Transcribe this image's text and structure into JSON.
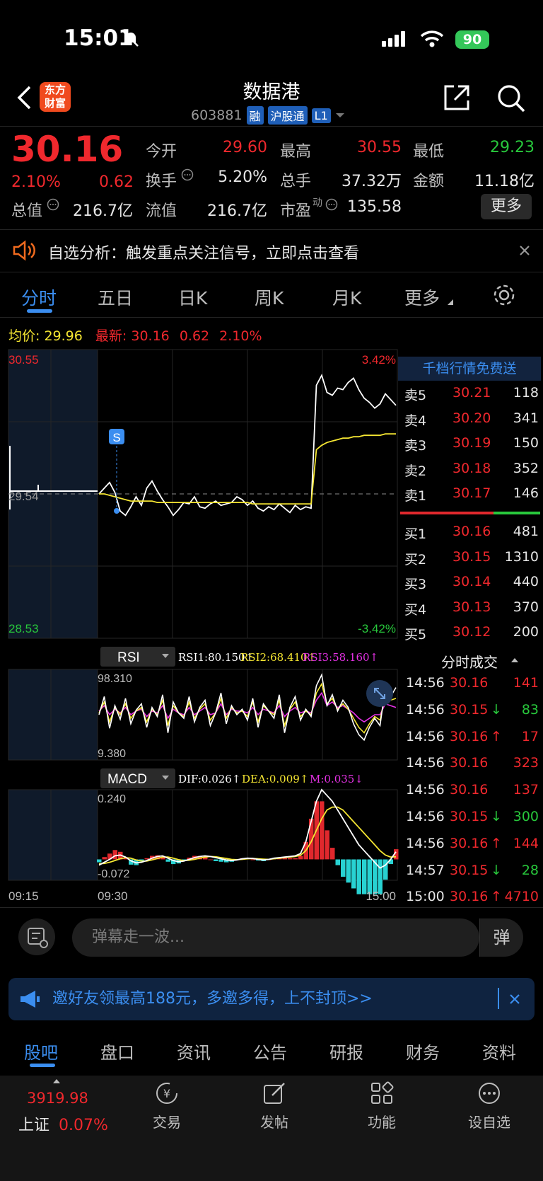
{
  "status_bar": {
    "time": "15:01",
    "battery": "90"
  },
  "header": {
    "logo_text": "东方财富",
    "title": "数据港",
    "code": "603881",
    "tags": [
      "融",
      "沪股通",
      "L1"
    ]
  },
  "quote": {
    "price": "30.16",
    "change_pct": "2.10%",
    "change": "0.62",
    "open_label": "今开",
    "open": "29.60",
    "high_label": "最高",
    "high": "30.55",
    "low_label": "最低",
    "low": "29.23",
    "turnover_label": "换手",
    "turnover": "5.20%",
    "volume_label": "总手",
    "volume": "37.32万",
    "amount_label": "金额",
    "amount": "11.18亿",
    "mktcap_label": "总值",
    "mktcap": "216.7亿",
    "float_label": "流值",
    "float": "216.7亿",
    "pe_label": "市盈",
    "pe_sup": "动",
    "pe": "135.58",
    "more": "更多"
  },
  "notice": {
    "text": "自选分析：触发重点关注信号，立即点击查看"
  },
  "chart_tabs": [
    "分时",
    "五日",
    "日K",
    "周K",
    "月K",
    "更多"
  ],
  "avg_line": {
    "avg_label": "均价:",
    "avg": "29.96",
    "latest_label": "最新:",
    "latest": "30.16",
    "change": "0.62",
    "pct": "2.10%"
  },
  "order_book": {
    "title": "千档行情免费送",
    "asks": [
      {
        "label": "卖5",
        "price": "30.21",
        "vol": "118"
      },
      {
        "label": "卖4",
        "price": "30.20",
        "vol": "341"
      },
      {
        "label": "卖3",
        "price": "30.19",
        "vol": "150"
      },
      {
        "label": "卖2",
        "price": "30.18",
        "vol": "352"
      },
      {
        "label": "卖1",
        "price": "30.17",
        "vol": "146"
      }
    ],
    "bids": [
      {
        "label": "买1",
        "price": "30.16",
        "vol": "481"
      },
      {
        "label": "买2",
        "price": "30.15",
        "vol": "1310"
      },
      {
        "label": "买3",
        "price": "30.14",
        "vol": "440"
      },
      {
        "label": "买4",
        "price": "30.13",
        "vol": "370"
      },
      {
        "label": "买5",
        "price": "30.12",
        "vol": "200"
      }
    ]
  },
  "trades": {
    "title": "分时成交",
    "rows": [
      {
        "time": "14:56",
        "price": "30.16",
        "arrow": "",
        "vol": "141",
        "dir": "up"
      },
      {
        "time": "14:56",
        "price": "30.15",
        "arrow": "↓",
        "vol": "83",
        "dir": "down"
      },
      {
        "time": "14:56",
        "price": "30.16",
        "arrow": "↑",
        "vol": "17",
        "dir": "up"
      },
      {
        "time": "14:56",
        "price": "30.16",
        "arrow": "",
        "vol": "323",
        "dir": "up"
      },
      {
        "time": "14:56",
        "price": "30.16",
        "arrow": "",
        "vol": "137",
        "dir": "up"
      },
      {
        "time": "14:56",
        "price": "30.15",
        "arrow": "↓",
        "vol": "300",
        "dir": "down"
      },
      {
        "time": "14:56",
        "price": "30.16",
        "arrow": "↑",
        "vol": "144",
        "dir": "up"
      },
      {
        "time": "14:57",
        "price": "30.15",
        "arrow": "↓",
        "vol": "28",
        "dir": "down"
      },
      {
        "time": "15:00",
        "price": "30.16",
        "arrow": "↑",
        "vol": "4710",
        "dir": "up"
      }
    ]
  },
  "chart_data": [
    {
      "type": "line",
      "series": [
        {
          "name": "最新"
        },
        {
          "name": "均价"
        }
      ],
      "y_top": "30.55",
      "y_mid": "29.54",
      "y_bottom": "28.53",
      "pct_top": "3.42%",
      "pct_bottom": "-3.42%",
      "signal_marker": "S",
      "y_range": [
        28.53,
        30.55
      ],
      "x_ticks": [
        "09:15",
        "09:30",
        "15:00"
      ],
      "price": [
        29.54,
        29.58,
        29.62,
        29.55,
        29.42,
        29.39,
        29.45,
        29.52,
        29.46,
        29.58,
        29.63,
        29.56,
        29.5,
        29.45,
        29.39,
        29.43,
        29.48,
        29.47,
        29.52,
        29.45,
        29.44,
        29.47,
        29.49,
        29.46,
        29.47,
        29.48,
        29.52,
        29.5,
        29.46,
        29.49,
        29.44,
        29.42,
        29.45,
        29.43,
        29.47,
        29.44,
        29.41,
        29.46,
        29.43,
        29.45,
        29.44,
        30.3,
        30.37,
        30.25,
        30.23,
        30.28,
        30.27,
        30.32,
        30.35,
        30.27,
        30.21,
        30.18,
        30.14,
        30.17,
        30.24,
        30.2,
        30.16
      ],
      "avg": [
        29.54,
        29.54,
        29.53,
        29.52,
        29.51,
        29.5,
        29.49,
        29.49,
        29.49,
        29.49,
        29.49,
        29.48,
        29.48,
        29.48,
        29.48,
        29.48,
        29.48,
        29.48,
        29.48,
        29.48,
        29.48,
        29.48,
        29.48,
        29.48,
        29.48,
        29.48,
        29.48,
        29.48,
        29.48,
        29.47,
        29.47,
        29.47,
        29.47,
        29.47,
        29.47,
        29.47,
        29.47,
        29.47,
        29.47,
        29.47,
        29.47,
        29.85,
        29.88,
        29.9,
        29.91,
        29.92,
        29.93,
        29.93,
        29.94,
        29.94,
        29.95,
        29.95,
        29.95,
        29.95,
        29.96,
        29.96,
        29.96
      ]
    },
    {
      "type": "line",
      "indicator": "RSI",
      "series": [
        {
          "name": "RSI1",
          "label": "RSI1:80.150",
          "arrow": "↑",
          "color": "#ffffff"
        },
        {
          "name": "RSI2",
          "label": "RSI2:68.410",
          "arrow": "↑",
          "color": "#f5e632"
        },
        {
          "name": "RSI3",
          "label": "RSI3:58.160",
          "arrow": "↑",
          "color": "#e632e6"
        }
      ],
      "y_top": "98.310",
      "y_bottom": "9.380",
      "y_range": [
        9.38,
        98.31
      ],
      "rsi1": [
        50,
        70,
        35,
        60,
        45,
        68,
        40,
        55,
        62,
        36,
        58,
        48,
        72,
        30,
        64,
        52,
        46,
        70,
        42,
        58,
        66,
        38,
        52,
        74,
        40,
        60,
        50,
        56,
        44,
        68,
        36,
        62,
        54,
        46,
        72,
        30,
        58,
        70,
        44,
        56,
        48,
        82,
        94,
        60,
        72,
        54,
        66,
        58,
        40,
        28,
        22,
        36,
        46,
        38,
        80,
        70,
        80
      ],
      "rsi2": [
        52,
        64,
        42,
        58,
        50,
        62,
        46,
        54,
        58,
        42,
        56,
        50,
        66,
        38,
        60,
        52,
        48,
        64,
        46,
        56,
        62,
        44,
        52,
        68,
        46,
        58,
        52,
        54,
        48,
        64,
        42,
        60,
        54,
        50,
        66,
        38,
        56,
        64,
        48,
        54,
        50,
        74,
        84,
        62,
        68,
        56,
        62,
        56,
        46,
        36,
        30,
        40,
        48,
        44,
        72,
        66,
        68
      ],
      "rsi3": [
        54,
        60,
        50,
        56,
        52,
        58,
        50,
        54,
        56,
        48,
        54,
        52,
        60,
        46,
        56,
        52,
        50,
        58,
        50,
        54,
        58,
        50,
        52,
        62,
        50,
        56,
        54,
        54,
        52,
        58,
        50,
        56,
        54,
        52,
        60,
        48,
        54,
        58,
        52,
        54,
        52,
        66,
        74,
        60,
        64,
        58,
        60,
        56,
        52,
        46,
        42,
        46,
        50,
        50,
        62,
        60,
        58
      ]
    },
    {
      "type": "bar",
      "indicator": "MACD",
      "series": [
        {
          "name": "DIF",
          "label": "DIF:0.026",
          "arrow": "↑",
          "color": "#ffffff"
        },
        {
          "name": "DEA",
          "label": "DEA:0.009",
          "arrow": "↑",
          "color": "#f5e632"
        },
        {
          "name": "M",
          "label": "M:0.035",
          "arrow": "↓",
          "color": "#e632e6"
        }
      ],
      "y_top": "0.240",
      "y_bottom": "-0.072",
      "y_range": [
        -0.072,
        0.24
      ],
      "dif": [
        -0.02,
        -0.01,
        0.0,
        0.012,
        0.015,
        0.008,
        -0.005,
        -0.012,
        -0.01,
        -0.004,
        0.004,
        0.01,
        0.012,
        0.004,
        -0.004,
        -0.008,
        -0.006,
        0.0,
        0.006,
        0.01,
        0.012,
        0.01,
        0.006,
        0.002,
        -0.002,
        -0.004,
        -0.002,
        0.002,
        0.004,
        0.003,
        0.0,
        -0.002,
        0.0,
        0.004,
        0.006,
        0.008,
        0.01,
        0.012,
        0.02,
        0.06,
        0.13,
        0.2,
        0.24,
        0.22,
        0.2,
        0.17,
        0.14,
        0.11,
        0.08,
        0.05,
        0.03,
        0.01,
        -0.01,
        -0.03,
        -0.02,
        0.0,
        0.026
      ],
      "dea": [
        -0.015,
        -0.014,
        -0.01,
        -0.004,
        0.002,
        0.006,
        0.004,
        -0.002,
        -0.006,
        -0.006,
        -0.002,
        0.003,
        0.008,
        0.008,
        0.004,
        -0.001,
        -0.004,
        -0.003,
        0.0,
        0.004,
        0.008,
        0.01,
        0.009,
        0.006,
        0.003,
        0.0,
        -0.001,
        0.0,
        0.002,
        0.003,
        0.002,
        0.001,
        0.0,
        0.002,
        0.004,
        0.006,
        0.008,
        0.01,
        0.014,
        0.03,
        0.06,
        0.1,
        0.14,
        0.17,
        0.18,
        0.18,
        0.17,
        0.15,
        0.13,
        0.11,
        0.09,
        0.07,
        0.05,
        0.03,
        0.015,
        0.008,
        0.009
      ],
      "m": [
        -0.01,
        0.008,
        0.02,
        0.032,
        0.026,
        0.004,
        -0.018,
        -0.02,
        -0.008,
        0.004,
        0.012,
        0.014,
        0.008,
        -0.008,
        -0.016,
        -0.014,
        -0.004,
        0.006,
        0.012,
        0.012,
        0.008,
        0.0,
        -0.006,
        -0.008,
        -0.01,
        -0.008,
        -0.002,
        0.004,
        0.004,
        0.0,
        -0.004,
        -0.006,
        0.0,
        0.004,
        0.004,
        0.004,
        0.004,
        0.004,
        0.012,
        0.06,
        0.14,
        0.2,
        0.2,
        0.1,
        0.04,
        -0.02,
        -0.06,
        -0.08,
        -0.1,
        -0.12,
        -0.12,
        -0.12,
        -0.12,
        -0.12,
        -0.07,
        -0.016,
        0.035
      ]
    }
  ],
  "danmaku": {
    "placeholder": "弹幕走一波...",
    "button": "弹"
  },
  "promo": {
    "text": "邀好友领最高188元，多邀多得，上不封顶>>"
  },
  "bottom_tabs": [
    "股吧",
    "盘口",
    "资讯",
    "公告",
    "研报",
    "财务",
    "资料"
  ],
  "toolbar": {
    "index_value": "3919.98",
    "index_name": "上证",
    "index_pct": "0.07%",
    "items": [
      "交易",
      "发帖",
      "功能",
      "设自选"
    ]
  }
}
